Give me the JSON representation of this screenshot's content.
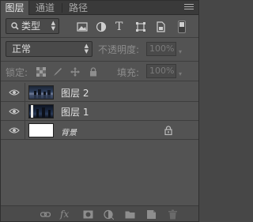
{
  "tabs": [
    {
      "label": "图层",
      "active": true
    },
    {
      "label": "通道",
      "active": false
    },
    {
      "label": "路径",
      "active": false
    }
  ],
  "filter": {
    "search_icon": "search-icon",
    "kind_label": "类型",
    "icons": [
      "image-filter-icon",
      "adjustment-filter-icon",
      "text-filter-icon",
      "shape-filter-icon",
      "smart-object-filter-icon"
    ]
  },
  "blend": {
    "mode": "正常",
    "opacity_label": "不透明度:",
    "opacity_value": "100%"
  },
  "lock": {
    "label": "锁定:",
    "icons": [
      "lock-transparent-icon",
      "lock-image-icon",
      "lock-position-icon",
      "lock-all-icon"
    ],
    "fill_label": "填充:",
    "fill_value": "100%"
  },
  "layers": [
    {
      "name": "图层 2",
      "visible": true,
      "locked": false,
      "thumb": "night-city"
    },
    {
      "name": "图层 1",
      "visible": true,
      "locked": false,
      "thumb": "night-city-dark"
    },
    {
      "name": "背景",
      "visible": true,
      "locked": true,
      "thumb": "white",
      "italic": true
    }
  ],
  "bottom_icons": [
    "link-icon",
    "fx-icon",
    "mask-icon",
    "adjustment-icon",
    "group-folder-icon",
    "new-layer-icon",
    "trash-icon"
  ],
  "colors": {
    "panel": "#535353",
    "tabbar": "#3a3a3a",
    "text": "#e2e2e2"
  }
}
